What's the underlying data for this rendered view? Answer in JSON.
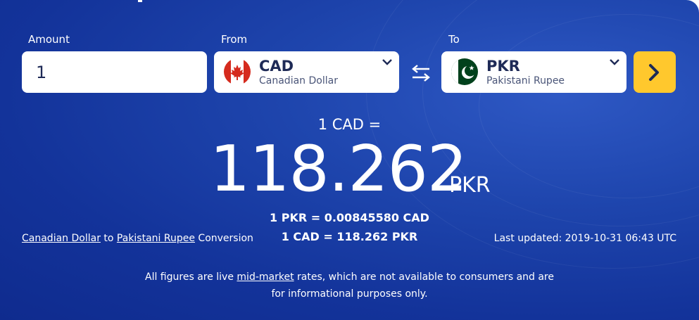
{
  "amount": {
    "label": "Amount",
    "value": "1"
  },
  "from": {
    "label": "From",
    "code": "CAD",
    "name": "Canadian Dollar",
    "flag_icon": "canada-flag-icon"
  },
  "to": {
    "label": "To",
    "code": "PKR",
    "name": "Pakistani Rupee",
    "flag_icon": "pakistan-flag-icon"
  },
  "swap_icon": "swap-arrows-icon",
  "submit_icon": "chevron-right-icon",
  "result": {
    "prefix": "1 CAD =",
    "value": "118.262",
    "currency": "PKR",
    "inverse_1": "1 PKR = 0.00845580 CAD",
    "inverse_2": "1 CAD = 118.262 PKR"
  },
  "conversion": {
    "from_link": "Canadian Dollar",
    "joiner": " to ",
    "to_link": "Pakistani Rupee",
    "suffix": " Conversion"
  },
  "last_updated": "Last updated: 2019-10-31 06:43 UTC",
  "note": {
    "before": "All figures are live ",
    "link": "mid-market",
    "after": " rates, which are not available to consumers and are for informational purposes only."
  },
  "colors": {
    "panel": "#1e45ad",
    "accent": "#ffc82d",
    "text_dark": "#1e2a56"
  }
}
